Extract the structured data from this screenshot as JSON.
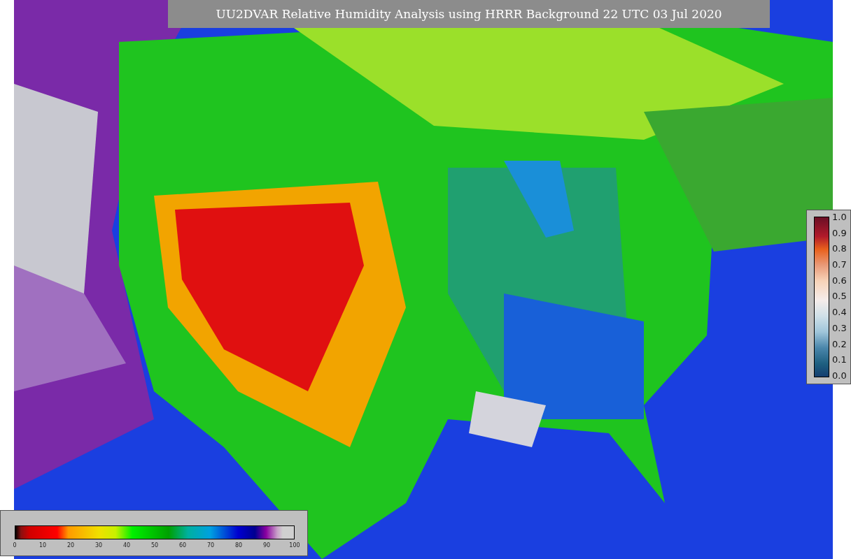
{
  "title": "UU2DVAR Relative Humidity Analysis using HRRR Background 22 UTC 03 Jul 2020",
  "ratio_legend": {
    "ticks": [
      "1.0",
      "0.9",
      "0.8",
      "0.7",
      "0.6",
      "0.5",
      "0.4",
      "0.3",
      "0.2",
      "0.1",
      "0.0"
    ]
  },
  "humidity_legend": {
    "ticks": [
      "0",
      "10",
      "20",
      "30",
      "40",
      "50",
      "60",
      "70",
      "80",
      "90",
      "100"
    ]
  }
}
